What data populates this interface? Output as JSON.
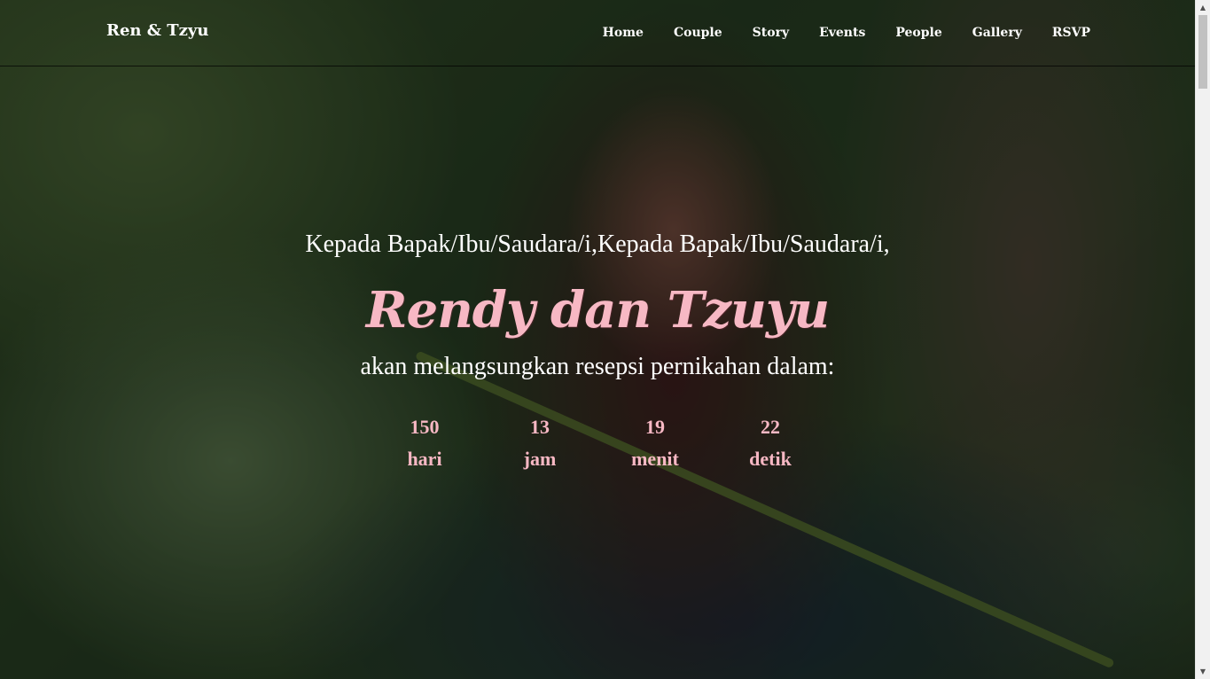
{
  "navbar": {
    "brand": "Ren & Tzyu",
    "items": [
      {
        "label": "Home"
      },
      {
        "label": "Couple"
      },
      {
        "label": "Story"
      },
      {
        "label": "Events"
      },
      {
        "label": "People"
      },
      {
        "label": "Gallery"
      },
      {
        "label": "RSVP"
      }
    ]
  },
  "hero": {
    "greeting": "Kepada Bapak/Ibu/Saudara/i,Kepada Bapak/Ibu/Saudara/i,",
    "couple_name": "Rendy dan Tzuyu",
    "subtitle": "akan melangsungkan resepsi pernikahan dalam:",
    "accent_color": "#f7b8c4",
    "countdown": [
      {
        "value": "150",
        "label": "hari"
      },
      {
        "value": "13",
        "label": "jam"
      },
      {
        "value": "19",
        "label": "menit"
      },
      {
        "value": "22",
        "label": "detik"
      }
    ]
  },
  "scrollbar": {
    "up_icon": "arrow-up-icon",
    "down_icon": "arrow-down-icon"
  }
}
